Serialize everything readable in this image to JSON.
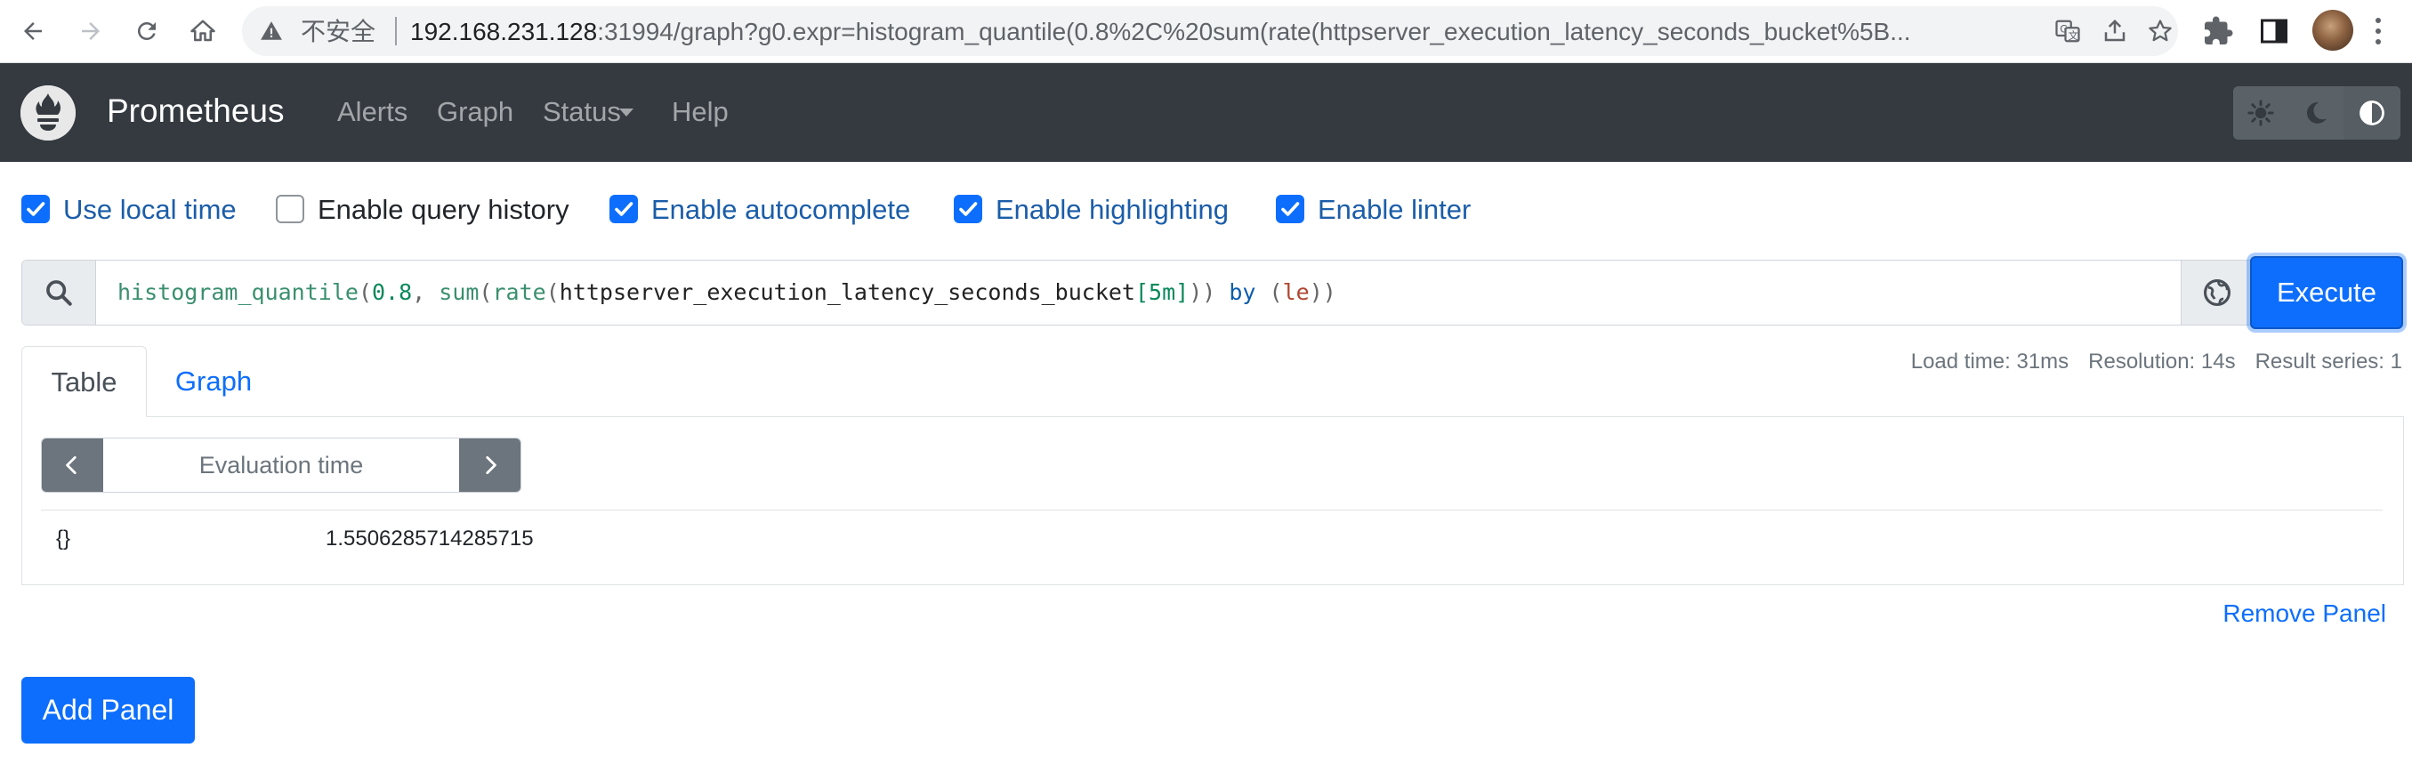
{
  "browser": {
    "security_label": "不安全",
    "url_host": "192.168.231.128",
    "url_rest": ":31994/graph?g0.expr=histogram_quantile(0.8%2C%20sum(rate(httpserver_execution_latency_seconds_bucket%5B..."
  },
  "navbar": {
    "brand": "Prometheus",
    "links": [
      "Alerts",
      "Graph",
      "Status",
      "Help"
    ]
  },
  "options": [
    {
      "label": "Use local time",
      "checked": true
    },
    {
      "label": "Enable query history",
      "checked": false
    },
    {
      "label": "Enable autocomplete",
      "checked": true
    },
    {
      "label": "Enable highlighting",
      "checked": true
    },
    {
      "label": "Enable linter",
      "checked": true
    }
  ],
  "query": {
    "tokens": {
      "fn1": "histogram_quantile",
      "p1": "(",
      "num": "0.8",
      "comma": ", ",
      "fn2": "sum",
      "p2": "(",
      "fn3": "rate",
      "p3": "(",
      "metric": "httpserver_execution_latency_seconds_bucket",
      "range": "[5m]",
      "p4": ")) ",
      "by": "by",
      "p5": " (",
      "label": "le",
      "p6": "))"
    },
    "execute_label": "Execute"
  },
  "tabs": {
    "table": "Table",
    "graph": "Graph"
  },
  "stats": {
    "load_time": "Load time: 31ms",
    "resolution": "Resolution: 14s",
    "result_series": "Result series: 1"
  },
  "table": {
    "eval_placeholder": "Evaluation time",
    "rows": [
      {
        "labels": "{}",
        "value": "1.5506285714285715"
      }
    ]
  },
  "actions": {
    "remove_panel": "Remove Panel",
    "add_panel": "Add Panel"
  },
  "colors": {
    "navbar_bg": "#343a40",
    "primary": "#0d6efd",
    "secondary": "#6c757d"
  }
}
